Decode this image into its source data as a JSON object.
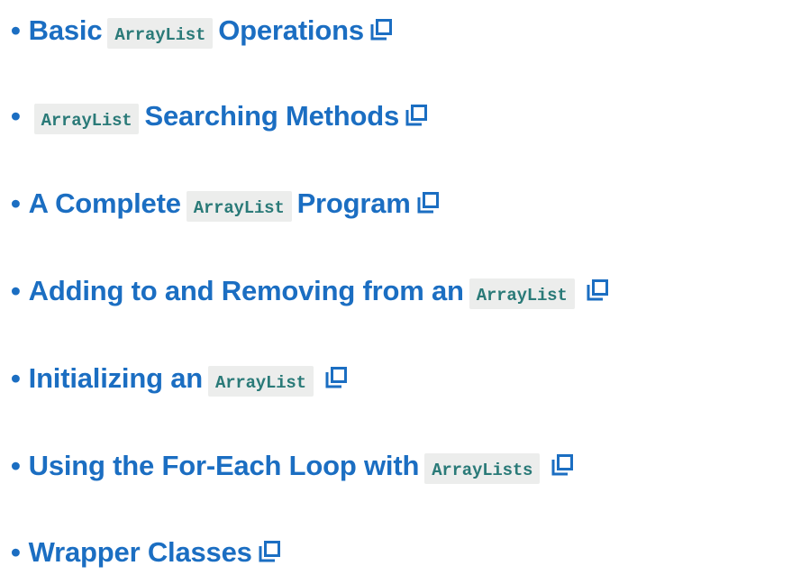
{
  "page": {
    "accent_color": "#1b6ec2",
    "code_color": "#2a7a78",
    "code_background": "#ecedec"
  },
  "links": [
    {
      "bullet": "•",
      "segments": [
        {
          "type": "text",
          "value": "Basic"
        },
        {
          "type": "code",
          "value": "ArrayList"
        },
        {
          "type": "text",
          "value": "Operations"
        }
      ],
      "icon": "external-link-icon"
    },
    {
      "bullet": "•",
      "segments": [
        {
          "type": "code",
          "value": "ArrayList"
        },
        {
          "type": "text",
          "value": "Searching Methods"
        }
      ],
      "icon": "external-link-icon"
    },
    {
      "bullet": "•",
      "segments": [
        {
          "type": "text",
          "value": "A Complete"
        },
        {
          "type": "code",
          "value": "ArrayList"
        },
        {
          "type": "text",
          "value": "Program"
        }
      ],
      "icon": "external-link-icon"
    },
    {
      "bullet": "•",
      "segments": [
        {
          "type": "text",
          "value": "Adding to and Removing from an"
        },
        {
          "type": "code",
          "value": "ArrayList"
        }
      ],
      "icon": "external-link-icon"
    },
    {
      "bullet": "•",
      "segments": [
        {
          "type": "text",
          "value": "Initializing an"
        },
        {
          "type": "code",
          "value": "ArrayList"
        }
      ],
      "icon": "external-link-icon"
    },
    {
      "bullet": "•",
      "segments": [
        {
          "type": "text",
          "value": "Using the For-Each Loop with"
        },
        {
          "type": "code",
          "value": "ArrayLists"
        }
      ],
      "icon": "external-link-icon"
    },
    {
      "bullet": "•",
      "segments": [
        {
          "type": "text",
          "value": "Wrapper Classes"
        }
      ],
      "icon": "external-link-icon"
    }
  ]
}
